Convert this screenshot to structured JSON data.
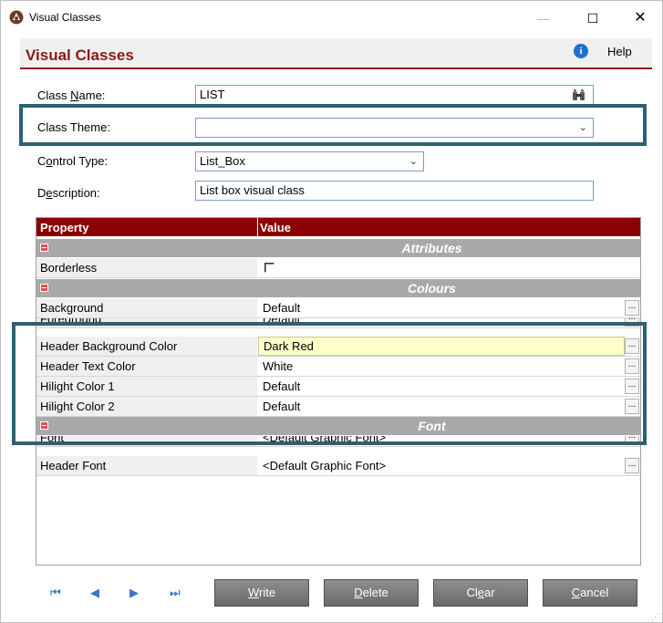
{
  "window": {
    "title": "Visual Classes"
  },
  "header": {
    "title": "Visual Classes",
    "help_label": "Help"
  },
  "form": {
    "class_name": {
      "label": "Class Name:",
      "value": "LIST"
    },
    "class_theme": {
      "label": "Class Theme:",
      "value": ""
    },
    "control_type": {
      "label": "Control Type:",
      "value": "List_Box"
    },
    "description": {
      "label": "Description:",
      "value": "List box visual class"
    }
  },
  "grid": {
    "col_property": "Property",
    "col_value": "Value",
    "cat_attributes": "Attributes",
    "cat_colours": "Colours",
    "cat_font": "Font",
    "rows": [
      {
        "name": "Borderless",
        "value": ""
      },
      {
        "name": "Background",
        "value": "Default"
      },
      {
        "name": "Foreground",
        "value": "Default"
      },
      {
        "name": "Header Background Color",
        "value": "Dark Red"
      },
      {
        "name": "Header Text Color",
        "value": "White"
      },
      {
        "name": "Hilight Color 1",
        "value": "Default"
      },
      {
        "name": "Hilight Color 2",
        "value": "Default"
      },
      {
        "name": "Font",
        "value": "<Default Graphic Font>"
      },
      {
        "name": "Header Font",
        "value": "<Default Graphic Font>"
      }
    ]
  },
  "toolbar": {
    "write": "Write",
    "delete": "Delete",
    "clear": "Clear",
    "cancel": "Cancel"
  },
  "icons": {
    "app": "app-logo-icon",
    "help": "info-icon",
    "lookup": "binoculars-icon",
    "dropdown": "chevron-down-icon",
    "first": "first-record-icon",
    "prev": "previous-record-icon",
    "next": "next-record-icon",
    "last": "last-record-icon"
  },
  "colors": {
    "accent": "#8b1a1a",
    "grid_header": "#8b0000",
    "highlight_box": "#2e6070",
    "selected_cell": "#fefeca"
  }
}
